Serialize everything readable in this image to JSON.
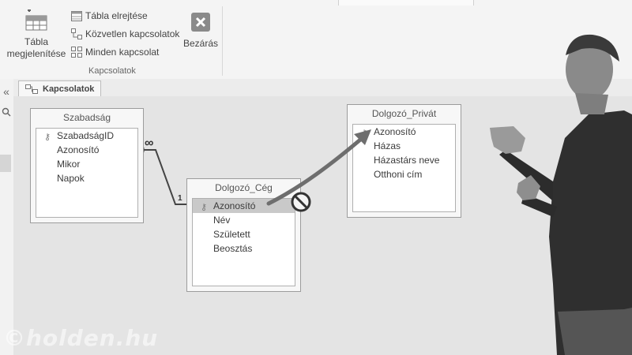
{
  "ribbon": {
    "show_table": "Tábla megjelenítése",
    "hide_table": "Tábla elrejtése",
    "direct_relations": "Közvetlen kapcsolatok",
    "all_relations": "Minden kapcsolat",
    "close": "Bezárás",
    "group_label": "Kapcsolatok"
  },
  "sidebar": {
    "collapse": "«"
  },
  "tab": {
    "label": "Kapcsolatok"
  },
  "tables": {
    "szabadsag": {
      "title": "Szabadság",
      "fields": [
        "SzabadságID",
        "Azonosító",
        "Mikor",
        "Napok"
      ]
    },
    "ceg": {
      "title": "Dolgozó_Cég",
      "fields": [
        "Azonosító",
        "Név",
        "Született",
        "Beosztás"
      ]
    },
    "privat": {
      "title": "Dolgozó_Privát",
      "fields": [
        "Azonosító",
        "Házas",
        "Házastárs neve",
        "Otthoni cím"
      ]
    }
  },
  "relation": {
    "one": "1",
    "many": "∞"
  },
  "watermark": "©holden.hu"
}
